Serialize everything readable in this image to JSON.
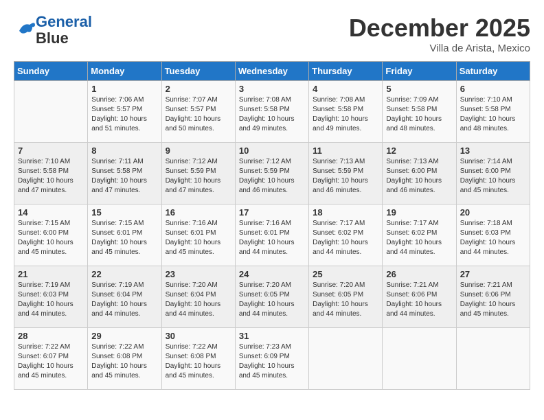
{
  "logo": {
    "line1": "General",
    "line2": "Blue"
  },
  "title": "December 2025",
  "subtitle": "Villa de Arista, Mexico",
  "weekdays": [
    "Sunday",
    "Monday",
    "Tuesday",
    "Wednesday",
    "Thursday",
    "Friday",
    "Saturday"
  ],
  "weeks": [
    [
      {
        "day": "",
        "info": ""
      },
      {
        "day": "1",
        "info": "Sunrise: 7:06 AM\nSunset: 5:57 PM\nDaylight: 10 hours\nand 51 minutes."
      },
      {
        "day": "2",
        "info": "Sunrise: 7:07 AM\nSunset: 5:57 PM\nDaylight: 10 hours\nand 50 minutes."
      },
      {
        "day": "3",
        "info": "Sunrise: 7:08 AM\nSunset: 5:58 PM\nDaylight: 10 hours\nand 49 minutes."
      },
      {
        "day": "4",
        "info": "Sunrise: 7:08 AM\nSunset: 5:58 PM\nDaylight: 10 hours\nand 49 minutes."
      },
      {
        "day": "5",
        "info": "Sunrise: 7:09 AM\nSunset: 5:58 PM\nDaylight: 10 hours\nand 48 minutes."
      },
      {
        "day": "6",
        "info": "Sunrise: 7:10 AM\nSunset: 5:58 PM\nDaylight: 10 hours\nand 48 minutes."
      }
    ],
    [
      {
        "day": "7",
        "info": "Sunrise: 7:10 AM\nSunset: 5:58 PM\nDaylight: 10 hours\nand 47 minutes."
      },
      {
        "day": "8",
        "info": "Sunrise: 7:11 AM\nSunset: 5:58 PM\nDaylight: 10 hours\nand 47 minutes."
      },
      {
        "day": "9",
        "info": "Sunrise: 7:12 AM\nSunset: 5:59 PM\nDaylight: 10 hours\nand 47 minutes."
      },
      {
        "day": "10",
        "info": "Sunrise: 7:12 AM\nSunset: 5:59 PM\nDaylight: 10 hours\nand 46 minutes."
      },
      {
        "day": "11",
        "info": "Sunrise: 7:13 AM\nSunset: 5:59 PM\nDaylight: 10 hours\nand 46 minutes."
      },
      {
        "day": "12",
        "info": "Sunrise: 7:13 AM\nSunset: 6:00 PM\nDaylight: 10 hours\nand 46 minutes."
      },
      {
        "day": "13",
        "info": "Sunrise: 7:14 AM\nSunset: 6:00 PM\nDaylight: 10 hours\nand 45 minutes."
      }
    ],
    [
      {
        "day": "14",
        "info": "Sunrise: 7:15 AM\nSunset: 6:00 PM\nDaylight: 10 hours\nand 45 minutes."
      },
      {
        "day": "15",
        "info": "Sunrise: 7:15 AM\nSunset: 6:01 PM\nDaylight: 10 hours\nand 45 minutes."
      },
      {
        "day": "16",
        "info": "Sunrise: 7:16 AM\nSunset: 6:01 PM\nDaylight: 10 hours\nand 45 minutes."
      },
      {
        "day": "17",
        "info": "Sunrise: 7:16 AM\nSunset: 6:01 PM\nDaylight: 10 hours\nand 44 minutes."
      },
      {
        "day": "18",
        "info": "Sunrise: 7:17 AM\nSunset: 6:02 PM\nDaylight: 10 hours\nand 44 minutes."
      },
      {
        "day": "19",
        "info": "Sunrise: 7:17 AM\nSunset: 6:02 PM\nDaylight: 10 hours\nand 44 minutes."
      },
      {
        "day": "20",
        "info": "Sunrise: 7:18 AM\nSunset: 6:03 PM\nDaylight: 10 hours\nand 44 minutes."
      }
    ],
    [
      {
        "day": "21",
        "info": "Sunrise: 7:19 AM\nSunset: 6:03 PM\nDaylight: 10 hours\nand 44 minutes."
      },
      {
        "day": "22",
        "info": "Sunrise: 7:19 AM\nSunset: 6:04 PM\nDaylight: 10 hours\nand 44 minutes."
      },
      {
        "day": "23",
        "info": "Sunrise: 7:20 AM\nSunset: 6:04 PM\nDaylight: 10 hours\nand 44 minutes."
      },
      {
        "day": "24",
        "info": "Sunrise: 7:20 AM\nSunset: 6:05 PM\nDaylight: 10 hours\nand 44 minutes."
      },
      {
        "day": "25",
        "info": "Sunrise: 7:20 AM\nSunset: 6:05 PM\nDaylight: 10 hours\nand 44 minutes."
      },
      {
        "day": "26",
        "info": "Sunrise: 7:21 AM\nSunset: 6:06 PM\nDaylight: 10 hours\nand 44 minutes."
      },
      {
        "day": "27",
        "info": "Sunrise: 7:21 AM\nSunset: 6:06 PM\nDaylight: 10 hours\nand 45 minutes."
      }
    ],
    [
      {
        "day": "28",
        "info": "Sunrise: 7:22 AM\nSunset: 6:07 PM\nDaylight: 10 hours\nand 45 minutes."
      },
      {
        "day": "29",
        "info": "Sunrise: 7:22 AM\nSunset: 6:08 PM\nDaylight: 10 hours\nand 45 minutes."
      },
      {
        "day": "30",
        "info": "Sunrise: 7:22 AM\nSunset: 6:08 PM\nDaylight: 10 hours\nand 45 minutes."
      },
      {
        "day": "31",
        "info": "Sunrise: 7:23 AM\nSunset: 6:09 PM\nDaylight: 10 hours\nand 45 minutes."
      },
      {
        "day": "",
        "info": ""
      },
      {
        "day": "",
        "info": ""
      },
      {
        "day": "",
        "info": ""
      }
    ]
  ]
}
